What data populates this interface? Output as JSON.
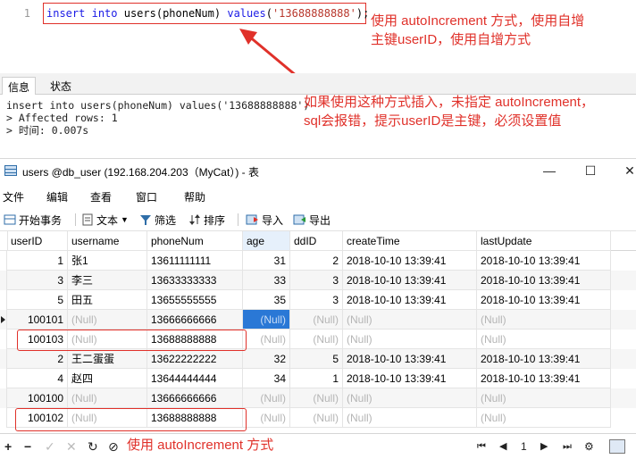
{
  "editor": {
    "line_number": "1",
    "code": {
      "kw1": "insert",
      "kw2": "into",
      "mid": "users(phoneNum)",
      "kw3": "values",
      "open": "(",
      "string": "'13688888888'",
      "close": ");"
    },
    "note_top_line1": "使用 autoIncrement 方式，使用自增",
    "note_top_line2": "主键userID，使用自增方式",
    "note_mid_line1": "如果使用这种方式插入，未指定 autoIncrement，",
    "note_mid_line2": "sql会报错，提示userID是主键，必须设置值"
  },
  "message": {
    "tabs": [
      "信息",
      "状态"
    ],
    "lines": [
      "insert into users(phoneNum) values('13688888888')",
      "> Affected rows: 1",
      "> 时间: 0.007s"
    ]
  },
  "window": {
    "title": "users @db_user (192.168.204.203（MyCat）) - 表",
    "menu": [
      "文件",
      "编辑",
      "查看",
      "窗口",
      "帮助"
    ],
    "toolbar": {
      "begin_txn": "开始事务",
      "text": "文本",
      "filter": "筛选",
      "sort": "排序",
      "import": "导入",
      "export": "导出"
    }
  },
  "grid": {
    "columns": [
      "userID",
      "username",
      "phoneNum",
      "age",
      "ddID",
      "createTime",
      "lastUpdate"
    ],
    "rows": [
      [
        "1",
        "张1",
        "13611111111",
        "31",
        "2",
        "2018-10-10 13:39:41",
        "2018-10-10 13:39:41"
      ],
      [
        "3",
        "李三",
        "13633333333",
        "33",
        "3",
        "2018-10-10 13:39:41",
        "2018-10-10 13:39:41"
      ],
      [
        "5",
        "田五",
        "13655555555",
        "35",
        "3",
        "2018-10-10 13:39:41",
        "2018-10-10 13:39:41"
      ],
      [
        "100101",
        "(Null)",
        "13666666666",
        "(Null)",
        "(Null)",
        "(Null)",
        "(Null)"
      ],
      [
        "100103",
        "(Null)",
        "13688888888",
        "(Null)",
        "(Null)",
        "(Null)",
        "(Null)"
      ],
      [
        "2",
        "王二蛋蛋",
        "13622222222",
        "32",
        "5",
        "2018-10-10 13:39:41",
        "2018-10-10 13:39:41"
      ],
      [
        "4",
        "赵四",
        "13644444444",
        "34",
        "1",
        "2018-10-10 13:39:41",
        "2018-10-10 13:39:41"
      ],
      [
        "100100",
        "(Null)",
        "13666666666",
        "(Null)",
        "(Null)",
        "(Null)",
        "(Null)"
      ],
      [
        "100102",
        "(Null)",
        "13688888888",
        "(Null)",
        "(Null)",
        "(Null)",
        "(Null)"
      ]
    ]
  },
  "bottom": {
    "note": "使用 autoIncrement 方式",
    "page": "1"
  },
  "colors": {
    "annotation_red": "#e0312a",
    "selection_blue": "#2a78d6",
    "null_gray": "#b5b5b5"
  }
}
